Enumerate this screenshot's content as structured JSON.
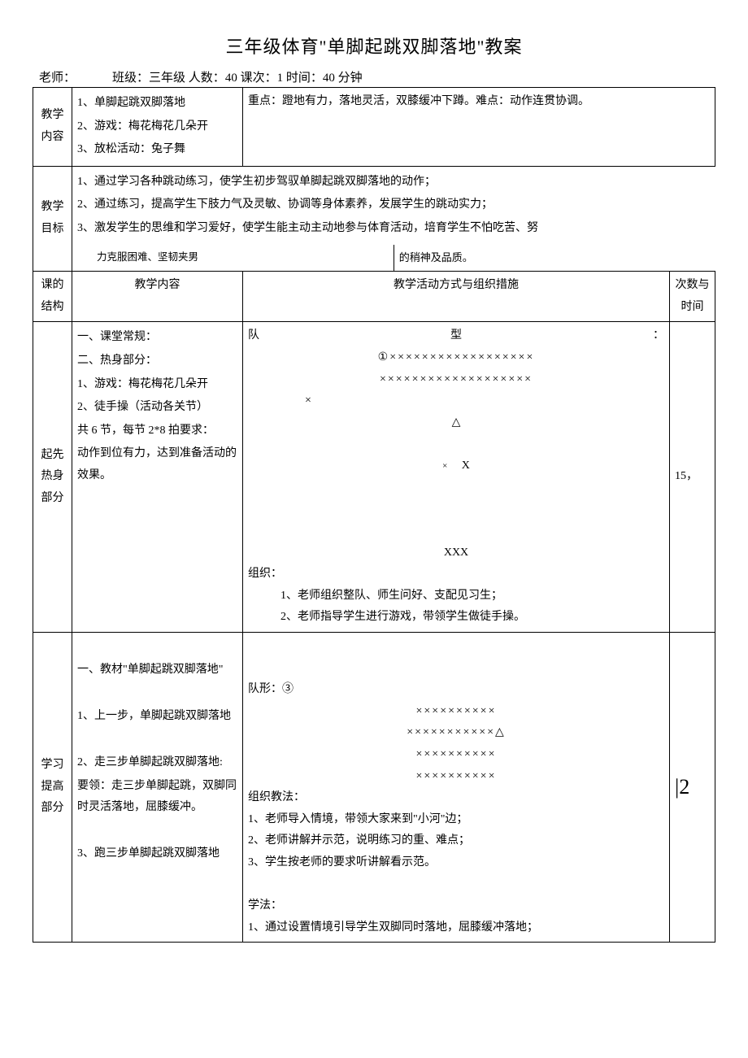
{
  "title": "三年级体育\"单脚起跳双脚落地\"教案",
  "meta": {
    "teacher_label": "老师：",
    "class_label": "班级：",
    "class_value": "三年级",
    "count_label": "人数：",
    "count_value": "40",
    "session_label": "课次：",
    "session_value": "1",
    "time_label": "时间：",
    "time_value": "40 分钟"
  },
  "labels": {
    "teach_content": "教学内容",
    "teach_goal": "教学目标",
    "struct": "课的结构",
    "struct_col2": "教学内容",
    "struct_col3": "教学活动方式与组织措施",
    "struct_col4": "次数与时间",
    "warmup": "起先热身部分",
    "learn": "学习提高部分"
  },
  "content_list": {
    "i1": "1、单脚起跳双脚落地",
    "i2": "2、游戏：梅花梅花几朵开",
    "i3": "3、放松活动：兔子舞",
    "keypoint": "重点：蹬地有力，落地灵活，双膝缓冲下蹲。难点：动作连贯协调。"
  },
  "goals": {
    "g1": "1、通过学习各种跳动练习，使学生初步驾驭单脚起跳双脚落地的动作；",
    "g2": "2、通过练习，提高学生下肢力气及灵敏、协调等身体素养，发展学生的跳动实力；",
    "g3_a": "3、激发学生的思维和学习爱好，使学生能主动主动地参与体育活动，培育学生不怕吃苦、努",
    "g3_b": "力克服困难、坚韧夹男",
    "g3_c": "的稍神及品质。"
  },
  "warmup": {
    "c1": "一、课堂常规：",
    "c2": "二、热身部分：",
    "c3": "1、游戏：梅花梅花几朵开",
    "c4": "2、徒手操（活动各关节）",
    "c5": "共 6 节，每节 2*8 拍要求：",
    "c6": "动作到位有力，达到准备活动的效果。",
    "formation_label": "队",
    "formation_label2": "型",
    "formation_colon": "：",
    "formation_num": "①",
    "row_x1": "××××××××××××××××××",
    "row_x2": "×××××××××××××××××××",
    "x_alone": "×",
    "tri": "△",
    "x_small1": "×",
    "x_small2": "X",
    "xxx": "XXX",
    "org_label": "组织：",
    "org1": "1、老师组织整队、师生问好、支配见习生；",
    "org2": "2、老师指导学生进行游戏，带领学生做徒手操。",
    "time": "15，"
  },
  "learn": {
    "c1": "一、教材\"单脚起跳双脚落地\"",
    "c2": "1、上一步，单脚起跳双脚落地",
    "c3": "2、走三步单脚起跳双脚落地:",
    "c4": "要领：走三步单脚起跳，双脚同时灵活落地，屈膝缓冲。",
    "c5": "3、跑三步单脚起跳双脚落地",
    "formation_label": "队形：③",
    "row1": "××××××××××",
    "row2": "×××××××××××△",
    "row3": "××××××××××",
    "row4": "××××××××××",
    "method_label": "组织教法：",
    "m1": "1、老师导入情境，带领大家来到\"小河\"边；",
    "m2": "2、老师讲解并示范，说明练习的重、难点；",
    "m3": "3、学生按老师的要求听讲解看示范。",
    "study_label": "学法：",
    "s1": "1、通过设置情境引导学生双脚同时落地，屈膝缓冲落地；",
    "time": "|2"
  }
}
